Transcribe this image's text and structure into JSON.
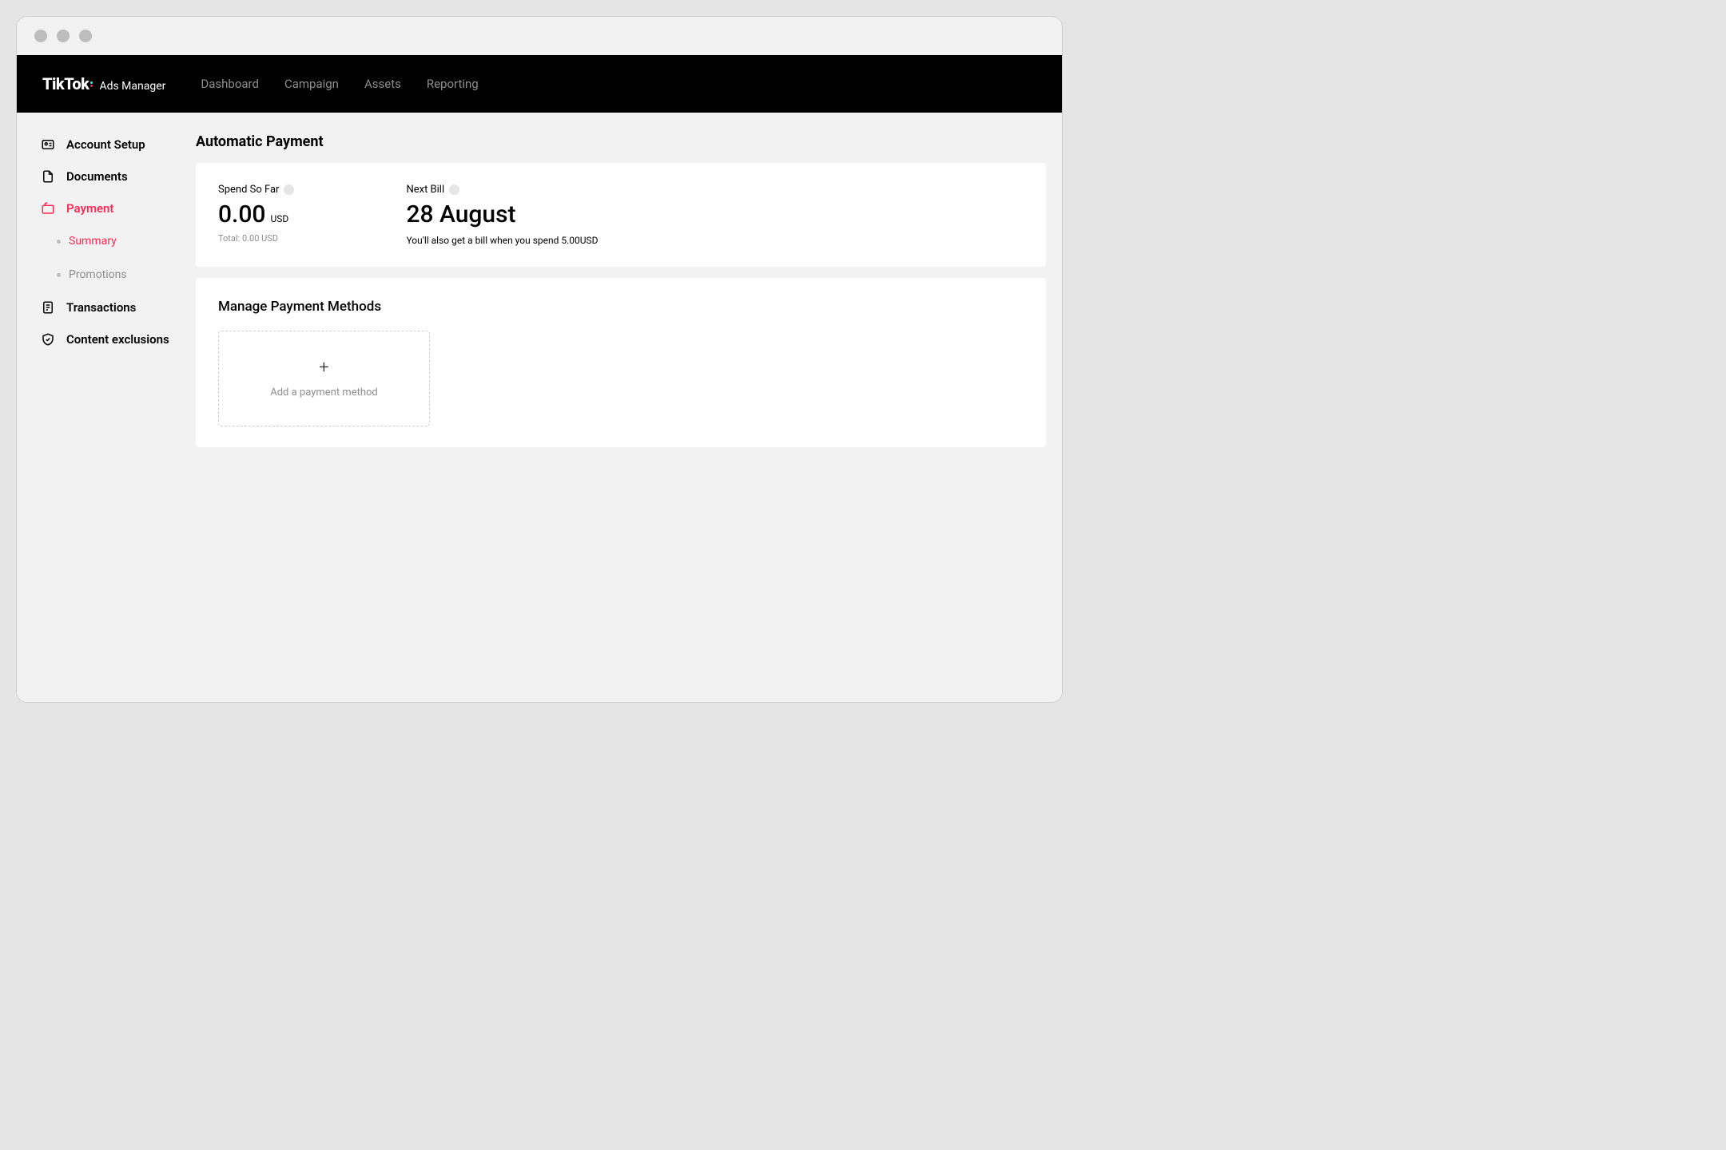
{
  "brand": {
    "name": "TikTok",
    "suffix": "Ads Manager"
  },
  "nav": {
    "items": [
      {
        "label": "Dashboard"
      },
      {
        "label": "Campaign"
      },
      {
        "label": "Assets"
      },
      {
        "label": "Reporting"
      }
    ]
  },
  "sidebar": {
    "items": [
      {
        "label": "Account Setup"
      },
      {
        "label": "Documents"
      },
      {
        "label": "Payment",
        "active": true
      },
      {
        "label": "Transactions"
      },
      {
        "label": "Content exclusions"
      }
    ],
    "payment_sub": [
      {
        "label": "Summary",
        "active": true
      },
      {
        "label": "Promotions"
      }
    ]
  },
  "page": {
    "title": "Automatic Payment"
  },
  "spend": {
    "label": "Spend So Far",
    "value": "0.00",
    "unit": "USD",
    "total": "Total: 0.00 USD"
  },
  "next_bill": {
    "label": "Next Bill",
    "value": "28 August",
    "note": "You'll also get a bill when you spend 5.00USD"
  },
  "payment_methods": {
    "title": "Manage Payment Methods",
    "add_label": "Add a payment method"
  },
  "colors": {
    "accent": "#fe2c55"
  }
}
